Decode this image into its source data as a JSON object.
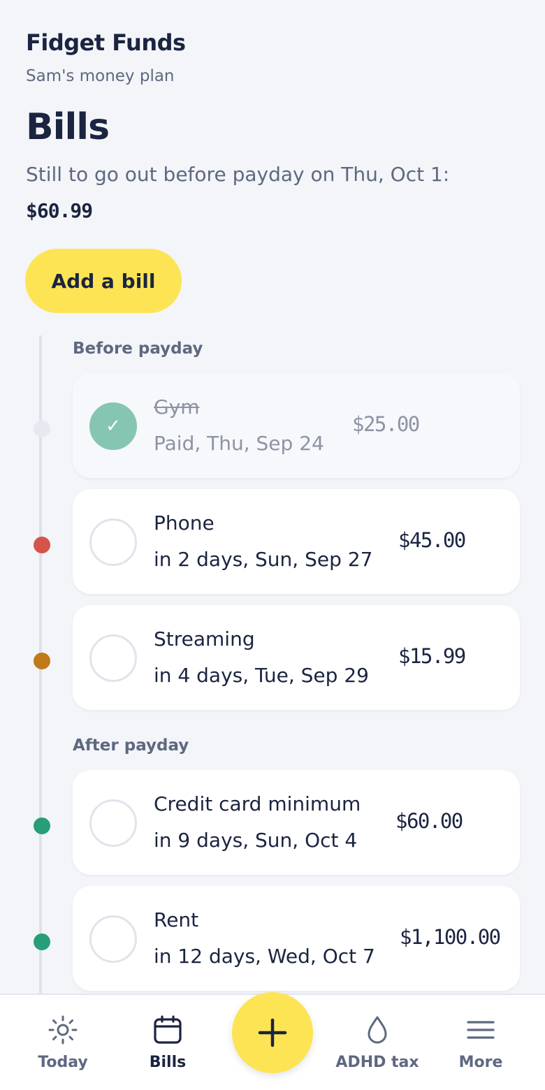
{
  "app": {
    "name": "Fidget Funds",
    "subtitle": "Sam's money plan"
  },
  "page": {
    "title": "Bills",
    "summary_text": "Still to go out before payday on Thu, Oct 1:",
    "summary_amount": "$60.99",
    "add_button_label": "Add a bill"
  },
  "groups": [
    {
      "label": "Before payday",
      "bills": [
        {
          "name": "Gym",
          "due": "Paid, Thu, Sep 24",
          "amount": "$25.00",
          "paid": true,
          "dot_color": "#e6e9ef"
        },
        {
          "name": "Phone",
          "due": "in 2 days, Sun, Sep 27",
          "amount": "$45.00",
          "paid": false,
          "dot_color": "#d5544a"
        },
        {
          "name": "Streaming",
          "due": "in 4 days, Tue, Sep 29",
          "amount": "$15.99",
          "paid": false,
          "dot_color": "#c07a1a"
        }
      ]
    },
    {
      "label": "After payday",
      "bills": [
        {
          "name": "Credit card minimum",
          "due": "in 9 days, Sun, Oct 4",
          "amount": "$60.00",
          "paid": false,
          "dot_color": "#279e78"
        },
        {
          "name": "Rent",
          "due": "in 12 days, Wed, Oct 7",
          "amount": "$1,100.00",
          "paid": false,
          "dot_color": "#279e78"
        }
      ]
    }
  ],
  "check_glyph": "✓",
  "nav": {
    "items": [
      {
        "label": "Today",
        "icon": "sun-icon",
        "active": false
      },
      {
        "label": "Bills",
        "icon": "calendar-icon",
        "active": true
      },
      {
        "label": "ADHD tax",
        "icon": "drop-icon",
        "active": false
      },
      {
        "label": "More",
        "icon": "menu-icon",
        "active": false
      }
    ],
    "fab_icon": "plus-icon"
  },
  "colors": {
    "accent": "#fde455",
    "text": "#1b2440",
    "muted": "#5e6880",
    "paid_check": "#86c5b2"
  }
}
